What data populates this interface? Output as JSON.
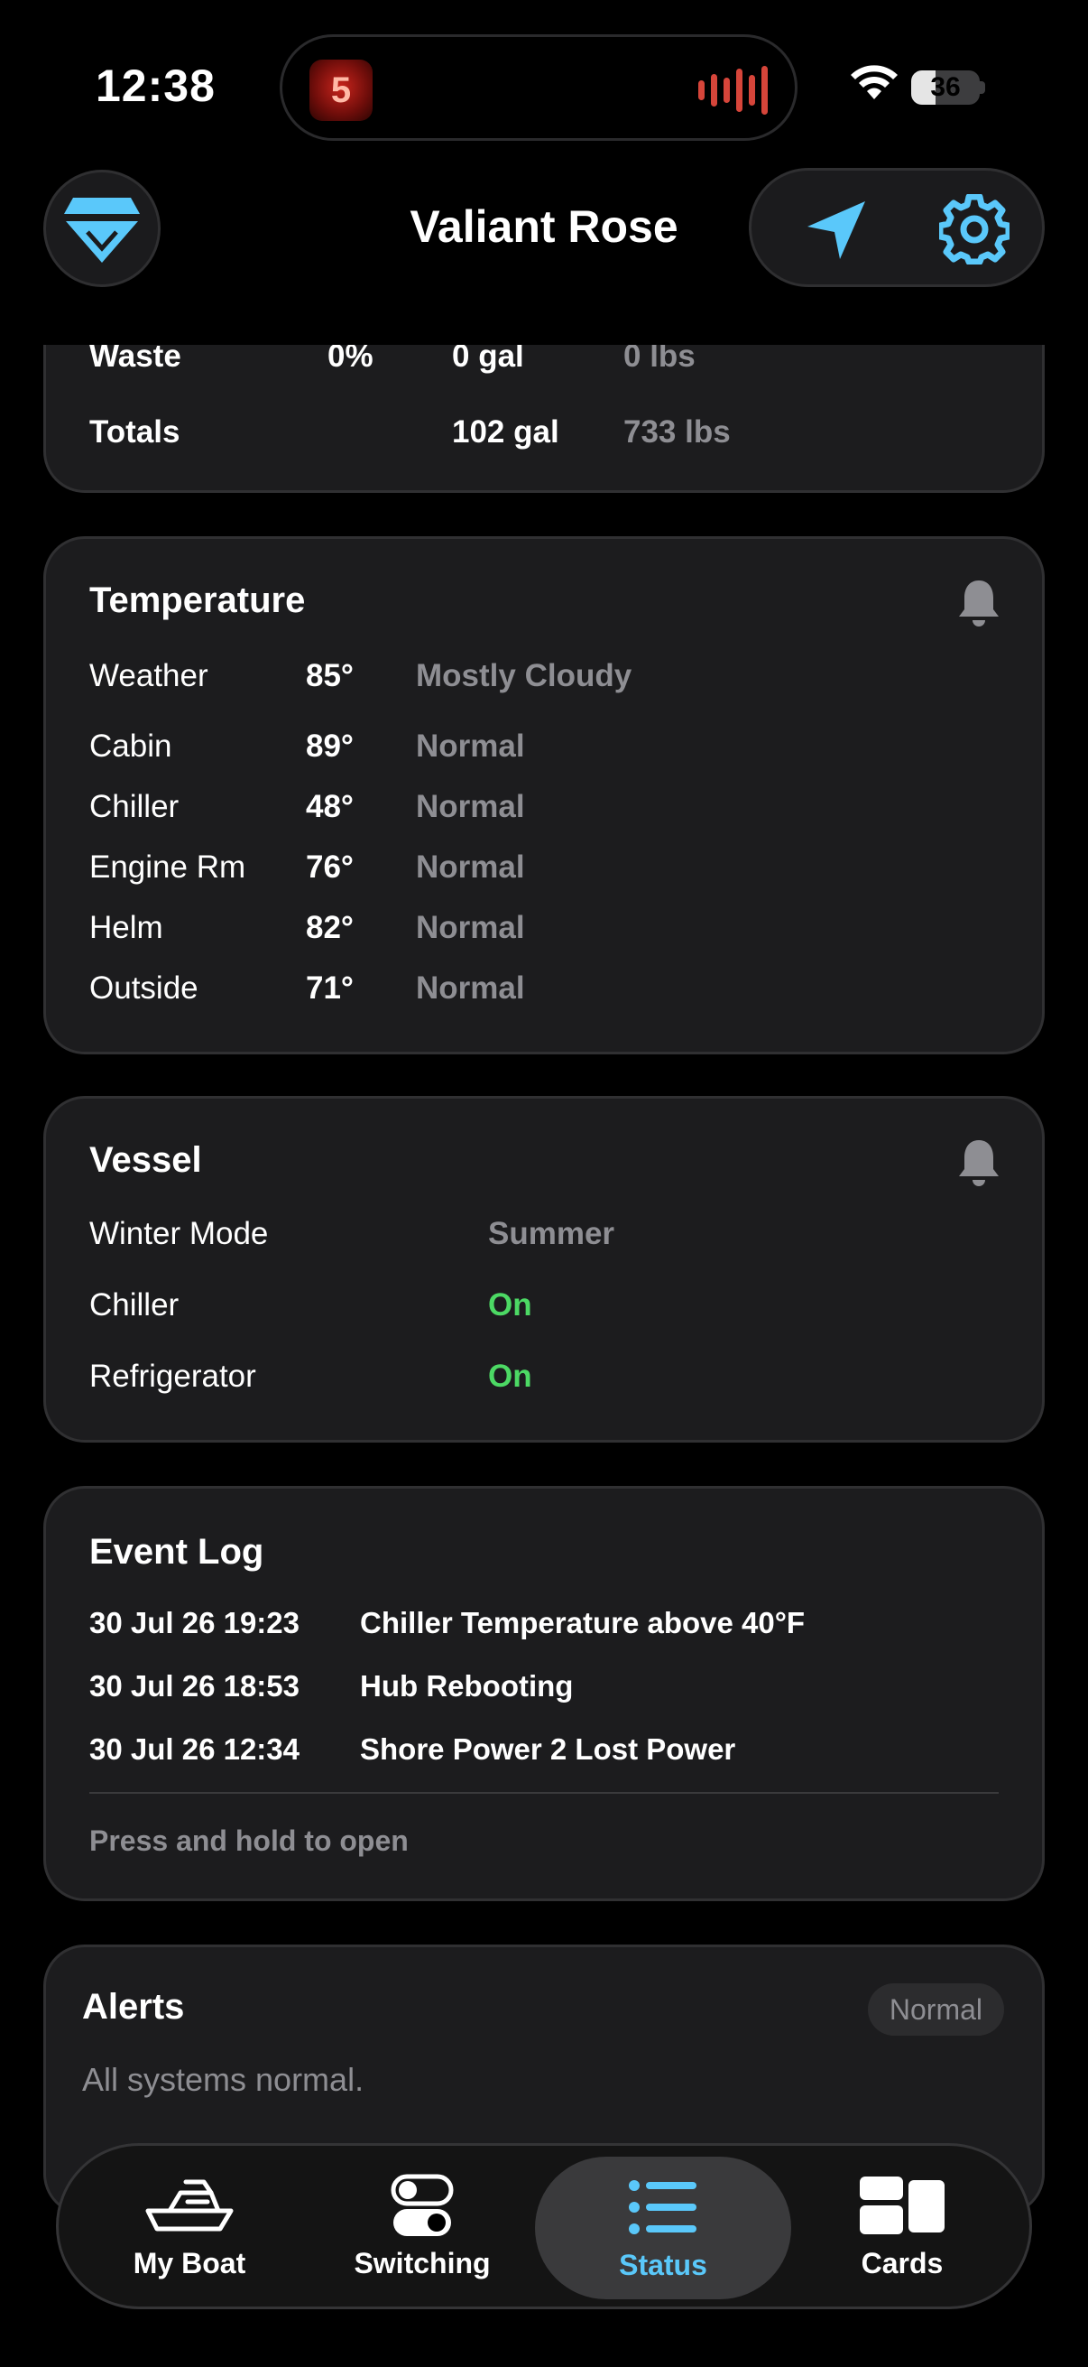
{
  "status_bar": {
    "time": "12:38",
    "battery": "36",
    "battery_level_percent": 36
  },
  "header": {
    "title": "Valiant Rose",
    "left_icon": "boat-bow-icon",
    "right_icons": [
      "navigation-arrow-icon",
      "gear-icon"
    ]
  },
  "tanks": {
    "partial_row": {
      "name": "Waste",
      "percent": "0%",
      "gal": "0 gal",
      "lbs": "0 lbs"
    },
    "totals": {
      "label": "Totals",
      "gal": "102 gal",
      "lbs": "733 lbs"
    }
  },
  "temperature": {
    "title": "Temperature",
    "rows": [
      {
        "name": "Weather",
        "value": "85°",
        "status": "Mostly Cloudy"
      },
      {
        "name": "Cabin",
        "value": "89°",
        "status": "Normal"
      },
      {
        "name": "Chiller",
        "value": "48°",
        "status": "Normal"
      },
      {
        "name": "Engine Rm",
        "value": "76°",
        "status": "Normal"
      },
      {
        "name": "Helm",
        "value": "82°",
        "status": "Normal"
      },
      {
        "name": "Outside",
        "value": "71°",
        "status": "Normal"
      }
    ]
  },
  "vessel": {
    "title": "Vessel",
    "rows": [
      {
        "name": "Winter Mode",
        "value": "Summer"
      },
      {
        "name": "Chiller",
        "value": "On"
      },
      {
        "name": "Refrigerator",
        "value": "On"
      }
    ]
  },
  "event_log": {
    "title": "Event Log",
    "events": [
      {
        "time": "30 Jul 26 19:23",
        "text": "Chiller Temperature above 40°F"
      },
      {
        "time": "30 Jul 26 18:53",
        "text": "Hub Rebooting"
      },
      {
        "time": "30 Jul 26 12:34",
        "text": "Shore Power 2 Lost Power"
      }
    ],
    "hint": "Press and hold to open"
  },
  "alerts": {
    "title": "Alerts",
    "badge": "Normal",
    "message": "All systems normal."
  },
  "tabs": [
    {
      "label": "My Boat",
      "icon": "boat-icon",
      "active": false
    },
    {
      "label": "Switching",
      "icon": "toggle-icon",
      "active": false
    },
    {
      "label": "Status",
      "icon": "list-icon",
      "active": true
    },
    {
      "label": "Cards",
      "icon": "cards-icon",
      "active": false
    }
  ],
  "colors": {
    "accent": "#5ac8fa",
    "on": "#4cd964",
    "card": "#1c1c1e",
    "secondary_text": "#8e8e93"
  }
}
